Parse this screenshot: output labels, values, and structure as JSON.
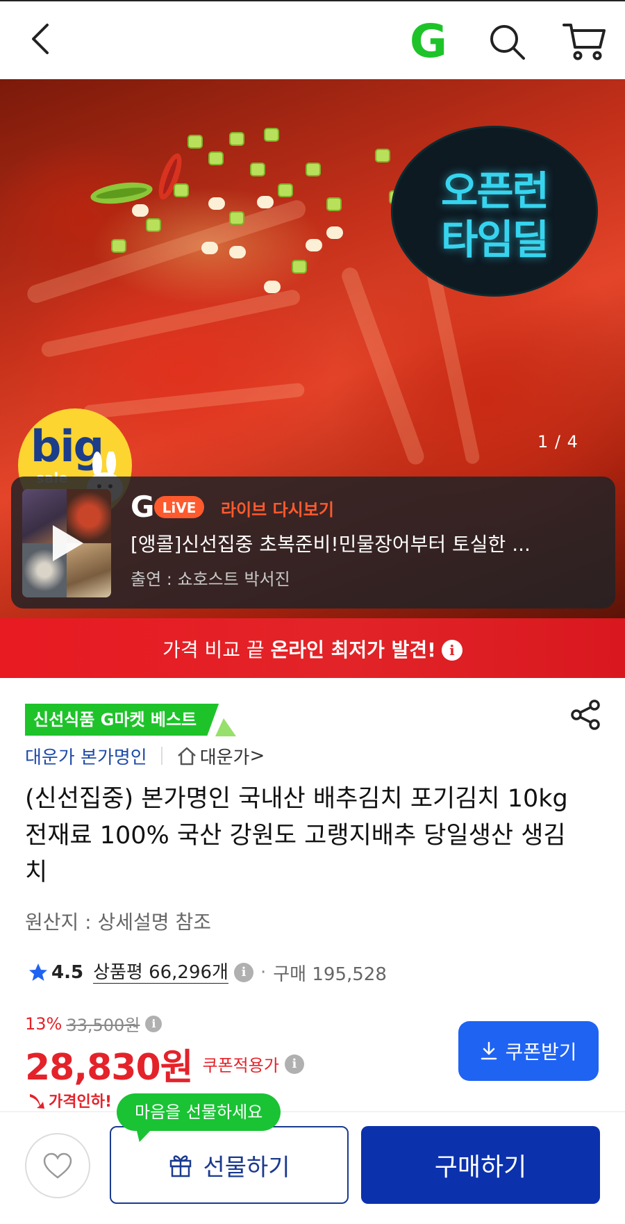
{
  "header": {
    "back_icon": "back-arrow-icon",
    "logo_letter": "G",
    "search_icon": "search-icon",
    "cart_icon": "cart-icon"
  },
  "hero": {
    "event_badge_line1": "오픈런",
    "event_badge_line2": "타임딜",
    "sale_badge_big": "big",
    "sale_badge_sale": "sale",
    "image_counter": "1 / 4",
    "live": {
      "logo_text": "LiVE",
      "title": "라이브 다시보기",
      "description": "[앵콜]신선집중 초복준비!민물장어부터 토실한 ...",
      "host": "출연 : 쇼호스트 박서진"
    }
  },
  "price_banner": {
    "prefix": "가격 비교 끝",
    "highlight": "온라인 최저가 발견!",
    "info_icon": "i"
  },
  "product": {
    "best_badge": "신선식품 G마켓 베스트",
    "seller": "대운가 본가명인",
    "store": "대운가",
    "store_chevron": ">",
    "title": "(신선집중) 본가명인 국내산 배추김치 포기김치 10kg 전재료 100% 국산 강원도 고랭지배추 당일생산 생김치",
    "origin": "원산지 : 상세설명 참조",
    "rating": "4.5",
    "reviews": "상품평 66,296개",
    "info_icon": "i",
    "separator": "·",
    "purchases": "구매 195,528",
    "discount_pct": "13%",
    "original_price": "33,500원",
    "price": "28,830원",
    "coupon_label": "쿠폰적용가",
    "coupon_button": "쿠폰받기",
    "price_drop": "가격인하!"
  },
  "bottom_bar": {
    "tooltip": "마음을 선물하세요",
    "gift_button": "선물하기",
    "buy_button": "구매하기"
  },
  "colors": {
    "gmarket_green": "#1ec32a",
    "price_red": "#e4222a",
    "coupon_blue": "#1f63f3",
    "buy_navy": "#0b31ad",
    "seller_blue": "#1f4aa8"
  }
}
